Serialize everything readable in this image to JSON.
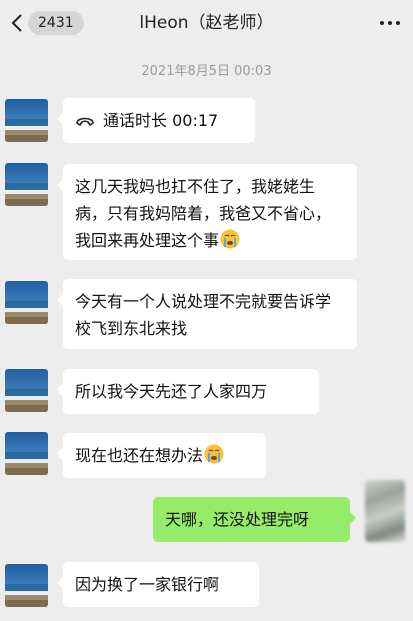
{
  "header": {
    "back_count": "2431",
    "title": "lHeon（赵老师）"
  },
  "timestamp": "2021年8月5日 00:03",
  "messages": [
    {
      "text": "通话时长 00:17"
    },
    {
      "text": "这几天我妈也扛不住了，我姥姥生病，只有我妈陪着，我爸又不省心，我回来再处理这个事"
    },
    {
      "text": "今天有一个人说处理不完就要告诉学校飞到东北来找"
    },
    {
      "text": "所以我今天先还了人家四万"
    },
    {
      "text": "现在也还在想办法"
    },
    {
      "text": "天哪，还没处理完呀"
    },
    {
      "text": "因为换了一家银行啊"
    }
  ],
  "colors": {
    "background": "#ededed",
    "incoming_bubble": "#ffffff",
    "outgoing_bubble": "#95ec69",
    "timestamp": "#9a9a9a"
  },
  "icons": [
    "back-chevron-icon",
    "more-dots-icon",
    "phone-call-icon",
    "crying-emoji-icon"
  ]
}
